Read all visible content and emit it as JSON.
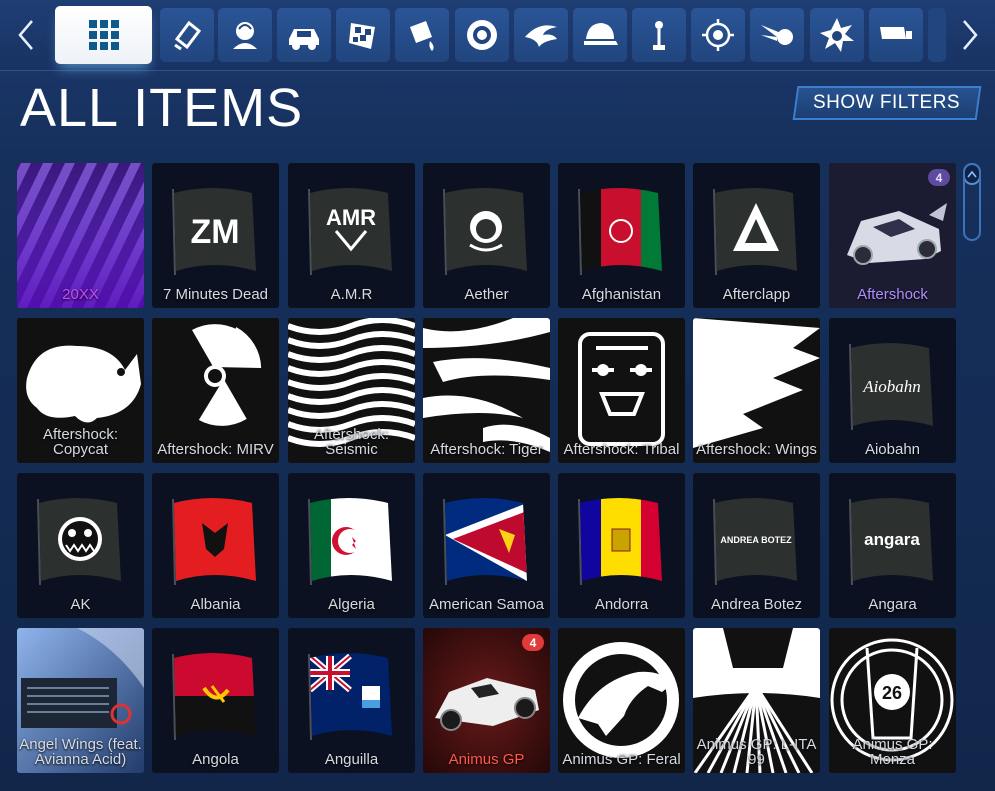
{
  "page": {
    "title": "ALL ITEMS",
    "filters_button": "SHOW FILTERS"
  },
  "tabs": [
    {
      "icon": "grid-icon",
      "active": true
    },
    {
      "icon": "decal-icon"
    },
    {
      "icon": "player-anthem-icon"
    },
    {
      "icon": "car-body-icon"
    },
    {
      "icon": "checkered-flag-icon"
    },
    {
      "icon": "paint-finish-icon"
    },
    {
      "icon": "wheels-icon"
    },
    {
      "icon": "boost-icon"
    },
    {
      "icon": "topper-cap-icon"
    },
    {
      "icon": "antenna-icon"
    },
    {
      "icon": "banner-emblem-icon"
    },
    {
      "icon": "trail-icon"
    },
    {
      "icon": "goal-explosion-icon"
    },
    {
      "icon": "engine-audio-icon"
    }
  ],
  "items": [
    {
      "label": "20XX",
      "art": "purple-stripes",
      "label_color": "#c74bff"
    },
    {
      "label": "7 Minutes Dead",
      "art": "flag-logo",
      "glyph": "ZM"
    },
    {
      "label": "A.M.R",
      "art": "flag-logo",
      "glyph": "AMR"
    },
    {
      "label": "Aether",
      "art": "flag-logo",
      "glyph": "face"
    },
    {
      "label": "Afghanistan",
      "art": "flag-country",
      "colors": [
        "#111111",
        "#c8102e",
        "#007a36"
      ]
    },
    {
      "label": "Afterclapp",
      "art": "flag-logo",
      "glyph": "delta"
    },
    {
      "label": "Aftershock",
      "art": "car-purple",
      "label_color": "#b08cff",
      "badge": "4",
      "badge_style": "purple"
    },
    {
      "label": "Aftershock: Copycat",
      "art": "decal-cat"
    },
    {
      "label": "Aftershock: MIRV",
      "art": "decal-radiation"
    },
    {
      "label": "Aftershock: Seismic",
      "art": "decal-waves"
    },
    {
      "label": "Aftershock: Tiger",
      "art": "decal-tiger"
    },
    {
      "label": "Aftershock: Tribal",
      "art": "decal-tribal"
    },
    {
      "label": "Aftershock: Wings",
      "art": "decal-wings"
    },
    {
      "label": "Aiobahn",
      "art": "flag-logo",
      "glyph": "Aiobahn"
    },
    {
      "label": "AK",
      "art": "flag-logo",
      "glyph": "ak-face"
    },
    {
      "label": "Albania",
      "art": "flag-country",
      "colors": [
        "#e41e20",
        "#e41e20",
        "#e41e20"
      ],
      "emblem": "eagle"
    },
    {
      "label": "Algeria",
      "art": "flag-country",
      "colors": [
        "#006633",
        "#ffffff",
        "#ffffff"
      ],
      "emblem": "crescent"
    },
    {
      "label": "American Samoa",
      "art": "flag-samoa"
    },
    {
      "label": "Andorra",
      "art": "flag-country",
      "colors": [
        "#10069f",
        "#fedd00",
        "#d50032"
      ]
    },
    {
      "label": "Andrea Botez",
      "art": "flag-logo",
      "glyph": "ANDREA BOTEZ"
    },
    {
      "label": "Angara",
      "art": "flag-logo",
      "glyph": "angara"
    },
    {
      "label": "Angel Wings (feat. Avianna Acid)",
      "art": "anthem-photo"
    },
    {
      "label": "Angola",
      "art": "flag-angola"
    },
    {
      "label": "Anguilla",
      "art": "flag-anguilla"
    },
    {
      "label": "Animus GP",
      "art": "car-red",
      "label_color": "#ff5a4a",
      "badge": "4",
      "badge_style": "red"
    },
    {
      "label": "Animus GP: Feral",
      "art": "decal-panther"
    },
    {
      "label": "Animus GP: L-ITA 99",
      "art": "decal-lines"
    },
    {
      "label": "Animus GP: Monza",
      "art": "decal-monza",
      "glyph": "26"
    }
  ]
}
